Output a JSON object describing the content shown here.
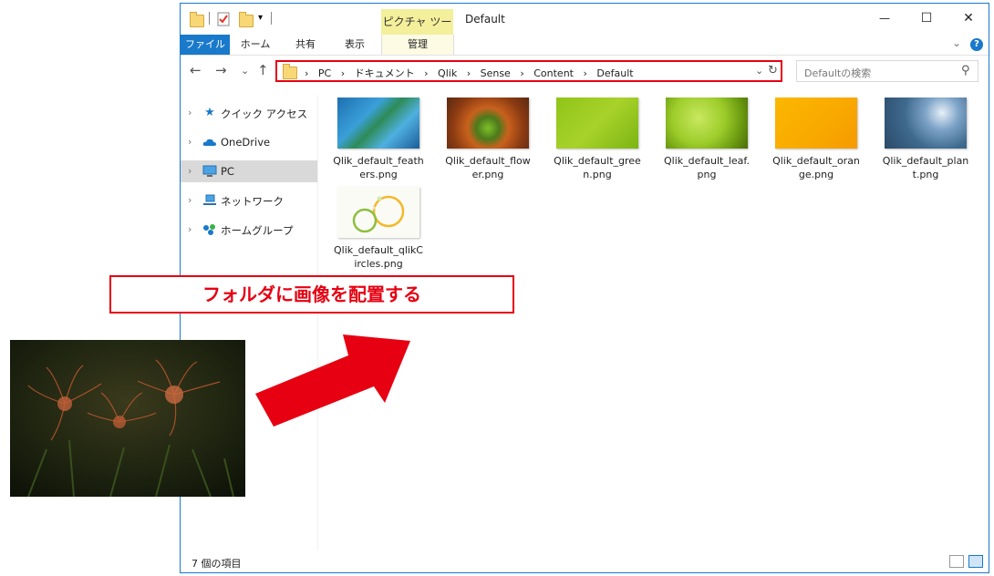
{
  "titlebar": {
    "context_tab": "ピクチャ ツール",
    "title": "Default",
    "minimize": "—",
    "maximize": "☐",
    "close": "✕"
  },
  "ribbon": {
    "tabs": [
      "ファイル",
      "ホーム",
      "共有",
      "表示",
      "管理"
    ],
    "expand": "⌄",
    "help": "?"
  },
  "nav": {
    "back": "←",
    "forward": "→",
    "recent": "⌄",
    "up": "↑"
  },
  "address": {
    "crumbs": [
      "PC",
      "ドキュメント",
      "Qlik",
      "Sense",
      "Content",
      "Default"
    ],
    "separator": "›",
    "dropdown": "⌄",
    "refresh": "↻"
  },
  "search": {
    "placeholder": "Defaultの検索",
    "icon": "⚲"
  },
  "navpane": {
    "items": [
      {
        "label": "クイック アクセス",
        "icon": "star-icon"
      },
      {
        "label": "OneDrive",
        "icon": "cloud-icon"
      },
      {
        "label": "PC",
        "icon": "computer-icon"
      },
      {
        "label": "ネットワーク",
        "icon": "network-icon"
      },
      {
        "label": "ホームグループ",
        "icon": "homegroup-icon"
      }
    ]
  },
  "files": [
    {
      "name": "Qlik_default_feathers.png"
    },
    {
      "name": "Qlik_default_flower.png"
    },
    {
      "name": "Qlik_default_green.png"
    },
    {
      "name": "Qlik_default_leaf.png"
    },
    {
      "name": "Qlik_default_orange.png"
    },
    {
      "name": "Qlik_default_plant.png"
    },
    {
      "name": "Qlik_default_qlikCircles.png"
    }
  ],
  "status": {
    "count": "7 個の項目"
  },
  "annotation": {
    "callout": "フォルダに画像を配置する",
    "accent_color": "#e60012"
  }
}
